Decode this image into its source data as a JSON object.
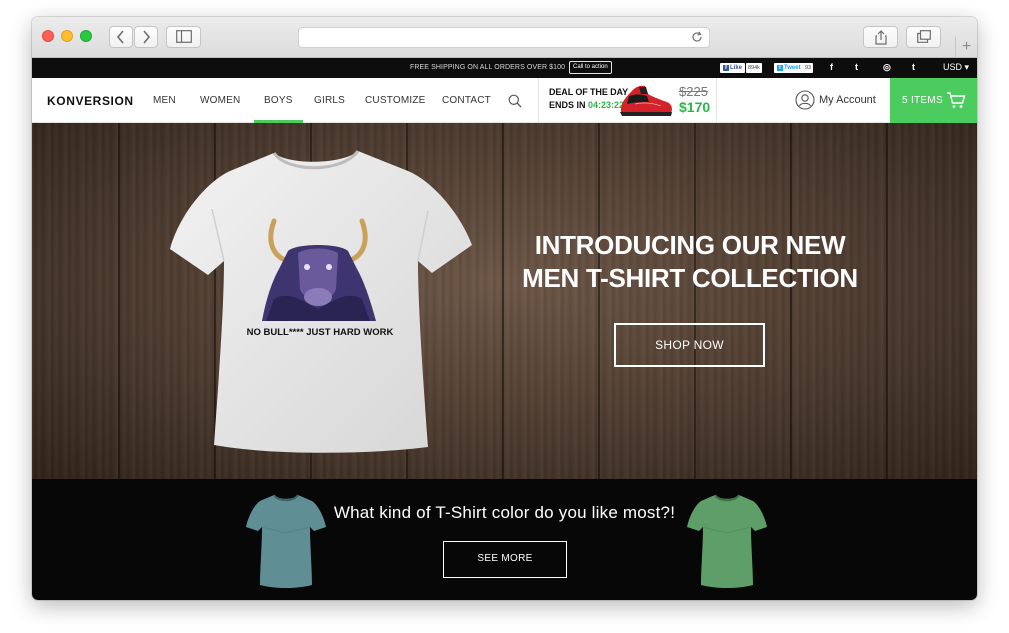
{
  "browser": {
    "url": ""
  },
  "topbar": {
    "shipping_text": "FREE SHIPPING ON ALL ORDERS OVER $100",
    "cta_label": "Call to action",
    "facebook_label": "Like",
    "facebook_count": "894k",
    "twitter_label": "Tweet",
    "twitter_count": "93",
    "social_icons": [
      "facebook-icon",
      "twitter-icon",
      "instagram-icon",
      "tumblr-icon"
    ],
    "facebook_icon_text": "f",
    "twitter_icon_text": "t",
    "instagram_icon_text": "◎",
    "tumblr_icon_text": "t",
    "currency": "USD ▾"
  },
  "nav": {
    "logo": "KONVERSION",
    "items": [
      {
        "label": "MEN"
      },
      {
        "label": "WOMEN"
      },
      {
        "label": "BOYS"
      },
      {
        "label": "GIRLS"
      },
      {
        "label": "CUSTOMIZE"
      },
      {
        "label": "CONTACT"
      }
    ],
    "active_item": "BOYS",
    "account_label": "My Account",
    "cart_label": "5 ITEMS"
  },
  "deal": {
    "line1": "DEAL OF THE DAY",
    "line2_prefix": "ENDS IN",
    "timer": "04:23:22",
    "old_price": "$225",
    "new_price": "$170"
  },
  "hero": {
    "shirt_print": "NO BULL**** JUST HARD WORK",
    "title_line1": "INTRODUCING OUR NEW",
    "title_line2": "MEN T-SHIRT COLLECTION",
    "button_label": "SHOP NOW"
  },
  "banner": {
    "question": "What kind of T-Shirt color do you like most?!",
    "button_label": "SEE MORE"
  },
  "colors": {
    "accent_green": "#4ccb5f",
    "price_green": "#2fb54a",
    "tee_blue": "#5f8f94",
    "tee_green": "#5e9e68"
  }
}
